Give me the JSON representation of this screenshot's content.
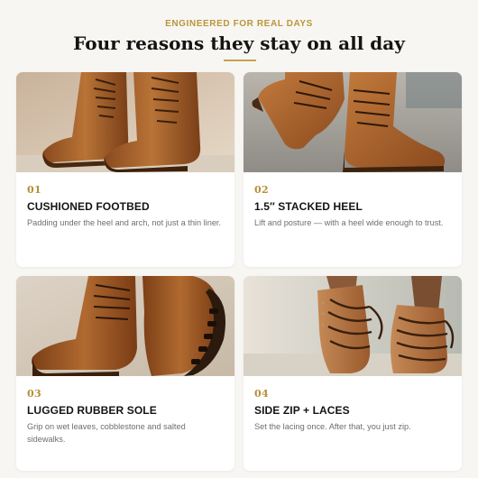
{
  "section": {
    "eyebrow": "ENGINEERED FOR REAL DAYS",
    "title": "Four reasons they stay on all day"
  },
  "features": [
    {
      "number": "01",
      "heading": "CUSHIONED FOOTBED",
      "description": "Padding under the heel and arch, not just a thin liner."
    },
    {
      "number": "02",
      "heading": "1.5″ STACKED HEEL",
      "description": "Lift and posture — with a heel wide enough to trust."
    },
    {
      "number": "03",
      "heading": "LUGGED RUBBER SOLE",
      "description": "Grip on wet leaves, cobblestone and salted sidewalks."
    },
    {
      "number": "04",
      "heading": "SIDE ZIP + LACES",
      "description": "Set the lacing once. After that, you just zip."
    }
  ],
  "colors": {
    "accent": "#c8a24a",
    "background": "#f8f6f3",
    "leather": "#a8602b"
  }
}
